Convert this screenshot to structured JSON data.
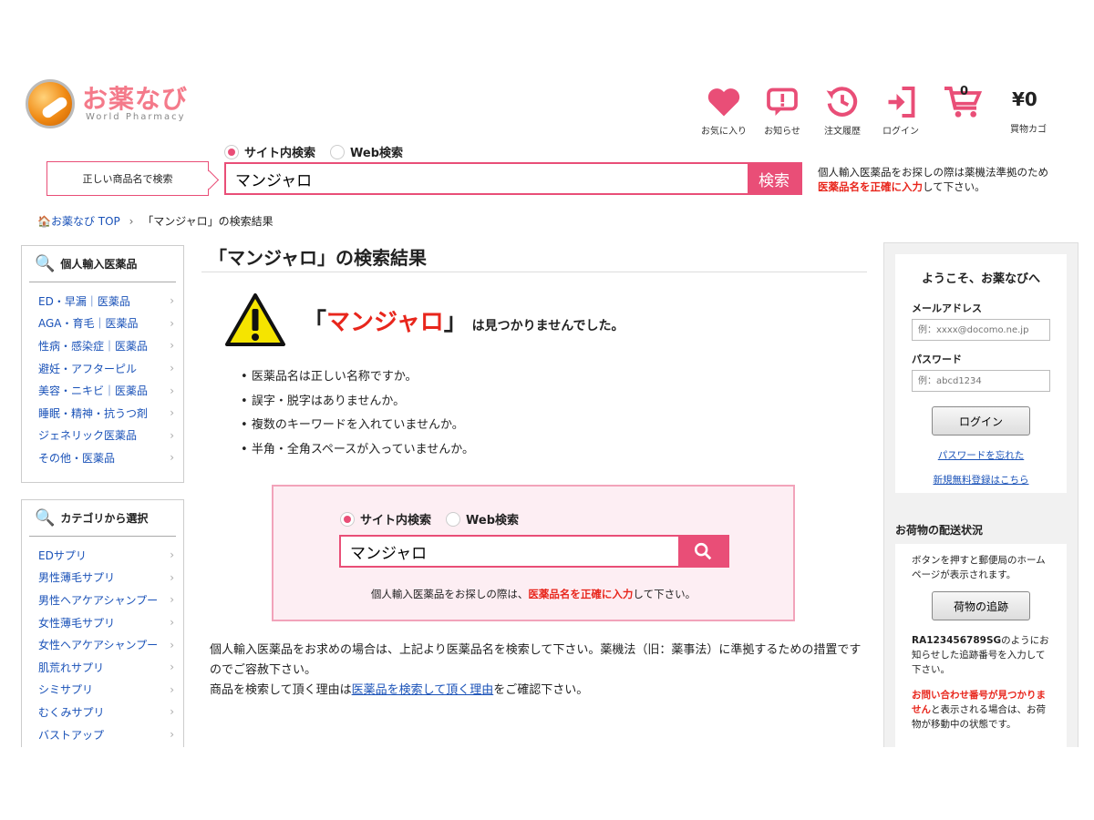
{
  "header": {
    "logo_text": "お薬なび",
    "logo_sub": "World Pharmacy",
    "icons": [
      {
        "label": "お気に入り",
        "icon": "heart-icon"
      },
      {
        "label": "お知らせ",
        "icon": "notice-icon"
      },
      {
        "label": "注文履歴",
        "icon": "history-icon"
      },
      {
        "label": "ログイン",
        "icon": "login-icon"
      }
    ],
    "cart": {
      "count": "0",
      "total": "¥0",
      "label": "買物カゴ"
    },
    "colors": {
      "accent": "#e94e77",
      "alert": "#e8261c",
      "link": "#1a52b8"
    }
  },
  "search": {
    "radio_site": "サイト内検索",
    "radio_web": "Web検索",
    "hint": "正しい商品名で検索",
    "value": "マンジャロ",
    "button": "検索",
    "note1": "個人輸入医薬品をお探しの際は薬機法準拠のため",
    "note_red": "医薬品名を正確に入力",
    "note2": "して下さい。"
  },
  "breadcrumb": {
    "home": "お薬なび TOP",
    "sep": "›",
    "current": "「マンジャロ」の検索結果"
  },
  "sidebar": {
    "box1_title": "個人輸入医薬品",
    "items1": [
      {
        "label": "ED・早漏｜医薬品"
      },
      {
        "label": "AGA・育毛｜医薬品"
      },
      {
        "label": "性病・感染症｜医薬品"
      },
      {
        "label": "避妊・アフターピル"
      },
      {
        "label": "美容・ニキビ｜医薬品"
      },
      {
        "label": "睡眠・精神・抗うつ剤"
      },
      {
        "label": "ジェネリック医薬品"
      },
      {
        "label": "その他・医薬品"
      }
    ],
    "box2_title": "カテゴリから選択",
    "items2": [
      {
        "label": "EDサプリ"
      },
      {
        "label": "男性薄毛サプリ"
      },
      {
        "label": "男性ヘアケアシャンプー"
      },
      {
        "label": "女性薄毛サプリ"
      },
      {
        "label": "女性ヘアケアシャンプー"
      },
      {
        "label": "肌荒れサプリ"
      },
      {
        "label": "シミサプリ"
      },
      {
        "label": "むくみサプリ"
      },
      {
        "label": "バストアップ"
      }
    ]
  },
  "main": {
    "title": "「マンジャロ」の検索結果",
    "nf_open": "「",
    "nf_keyword": "マンジャロ",
    "nf_close": "」",
    "nf_rest": " は見つかりませんでした。",
    "tips": [
      "医薬品名は正しい名称ですか。",
      "誤字・脱字はありませんか。",
      "複数のキーワードを入れていませんか。",
      "半角・全角スペースが入っていませんか。"
    ],
    "box_note1": "個人輸入医薬品をお探しの際は、",
    "box_note_red": "医薬品名を正確に入力",
    "box_note2": "して下さい。",
    "bottom1": "個人輸入医薬品をお求めの場合は、上記より医薬品名を検索して下さい。薬機法（旧：薬事法）に準拠するための措置ですのでご容赦下さい。",
    "bottom2_pre": "商品を検索して頂く理由は",
    "bottom2_link": "医薬品を検索して頂く理由",
    "bottom2_post": "をご確認下さい。"
  },
  "right": {
    "welcome": "ようこそ、お薬なびへ",
    "email_label": "メールアドレス",
    "email_ph": "例：xxxx@docomo.ne.jp",
    "pw_label": "パスワード",
    "pw_ph": "例：abcd1234",
    "login_btn": "ログイン",
    "forgot": "パスワードを忘れた",
    "register": "新規無料登録はこちら",
    "ship_title": "お荷物の配送状況",
    "ship_desc": "ボタンを押すと郵便局のホームページが表示されます。",
    "track_btn": "荷物の追跡",
    "ship_code": "RA123456789SG",
    "ship_code_rest": "のようにお知らせした追跡番号を入力して下さい。",
    "ship_warn_red": "お問い合わせ番号が見つかりません",
    "ship_warn_rest": "と表示される場合は、お荷物が移動中の状態です。"
  }
}
